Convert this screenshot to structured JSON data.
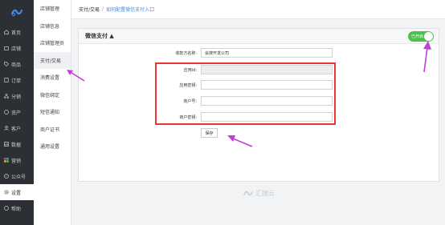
{
  "sidebar": {
    "items": [
      {
        "label": "首页",
        "icon": "home-icon"
      },
      {
        "label": "店铺",
        "icon": "store-icon"
      },
      {
        "label": "商品",
        "icon": "tag-icon"
      },
      {
        "label": "订单",
        "icon": "order-icon"
      },
      {
        "label": "分销",
        "icon": "share-icon"
      },
      {
        "label": "资产",
        "icon": "coin-icon"
      },
      {
        "label": "客户",
        "icon": "user-icon"
      },
      {
        "label": "数据",
        "icon": "chart-icon"
      },
      {
        "label": "营销",
        "icon": "grid-icon"
      },
      {
        "label": "公众号",
        "icon": "wechat-icon"
      },
      {
        "label": "设置",
        "icon": "gear-icon"
      },
      {
        "label": "帮助",
        "icon": "help-icon"
      }
    ]
  },
  "submenu": {
    "items": [
      {
        "label": "店铺管理"
      },
      {
        "label": "店铺信息"
      },
      {
        "label": "店铺管理员"
      },
      {
        "label": "支付/交易"
      },
      {
        "label": "消费设置"
      },
      {
        "label": "微信绑定"
      },
      {
        "label": "短信通知"
      },
      {
        "label": "商户证书"
      },
      {
        "label": "通用设置"
      }
    ]
  },
  "breadcrumb": {
    "parent": "支付/交易",
    "separator": "/",
    "current": "如何配置微信支付入口"
  },
  "panel": {
    "title": "微信支付 ▲",
    "switch_label": "已开启"
  },
  "form": {
    "payee_label": "收款方名称:",
    "payee_value": "会搜开发公司",
    "appid_label": "应用id:",
    "appid_value": "",
    "secret_label": "应用密钥:",
    "secret_value": "",
    "mchid_label": "商户号:",
    "mchid_value": "",
    "mchkey_label": "商户密钥:",
    "mchkey_value": "",
    "save_label": "保存"
  },
  "footer": {
    "brand": "汇搜云"
  },
  "colors": {
    "sidebar_bg": "#2c2f33",
    "switch_on": "#4cc24b",
    "highlight_red": "#e33333",
    "annotation_arrow": "#c040d8",
    "link_blue": "#3a8ee6"
  }
}
